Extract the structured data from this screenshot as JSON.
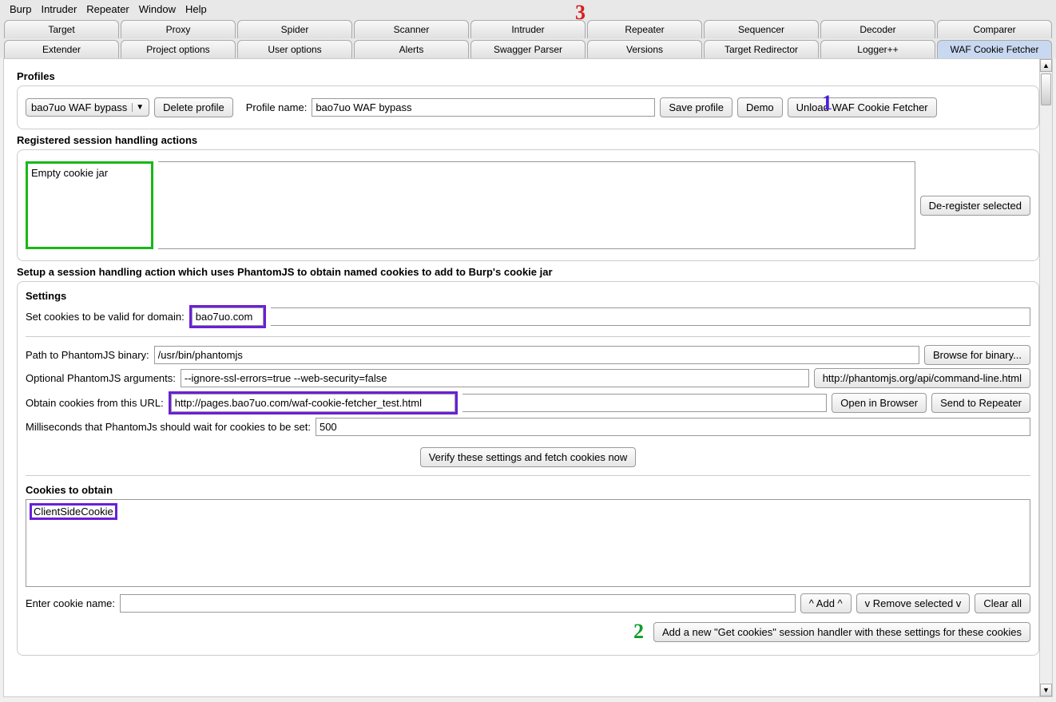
{
  "menu": {
    "items": [
      "Burp",
      "Intruder",
      "Repeater",
      "Window",
      "Help"
    ]
  },
  "tabs_top": [
    "Target",
    "Proxy",
    "Spider",
    "Scanner",
    "Intruder",
    "Repeater",
    "Sequencer",
    "Decoder",
    "Comparer"
  ],
  "tabs_bottom": [
    "Extender",
    "Project options",
    "User options",
    "Alerts",
    "Swagger Parser",
    "Versions",
    "Target Redirector",
    "Logger++",
    "WAF Cookie Fetcher"
  ],
  "active_tab": "WAF Cookie Fetcher",
  "annotations": {
    "one": "1",
    "two": "2",
    "three": "3"
  },
  "profiles": {
    "title": "Profiles",
    "selected": "bao7uo WAF bypass",
    "delete_btn": "Delete profile",
    "name_label": "Profile name:",
    "name_value": "bao7uo WAF bypass",
    "save_btn": "Save profile",
    "demo_btn": "Demo",
    "unload_btn": "Unload WAF Cookie Fetcher"
  },
  "registered": {
    "title": "Registered session handling actions",
    "item": "Empty cookie jar",
    "deregister_btn": "De-register selected"
  },
  "setup_title": "Setup a session handling action which uses PhantomJS to obtain named cookies to add to Burp's cookie jar",
  "settings": {
    "title": "Settings",
    "domain_label": "Set cookies to be valid for domain:",
    "domain_value": "bao7uo.com",
    "path_label": "Path to PhantomJS binary:",
    "path_value": "/usr/bin/phantomjs",
    "browse_btn": "Browse for binary...",
    "args_label": "Optional PhantomJS arguments:",
    "args_value": "--ignore-ssl-errors=true --web-security=false",
    "args_link": "http://phantomjs.org/api/command-line.html",
    "url_label": "Obtain cookies from this URL:",
    "url_value": "http://pages.bao7uo.com/waf-cookie-fetcher_test.html",
    "open_btn": "Open in Browser",
    "send_btn": "Send to Repeater",
    "ms_label": "Milliseconds that PhantomJs should wait for cookies to be set:",
    "ms_value": "500",
    "verify_btn": "Verify these settings and fetch cookies now"
  },
  "cookies": {
    "title": "Cookies to obtain",
    "item": "ClientSideCookie",
    "enter_label": "Enter cookie name:",
    "add_btn": "^ Add ^",
    "remove_btn": "v Remove selected v",
    "clear_btn": "Clear all",
    "handler_btn": "Add a new \"Get cookies\" session handler with these settings for these cookies"
  }
}
